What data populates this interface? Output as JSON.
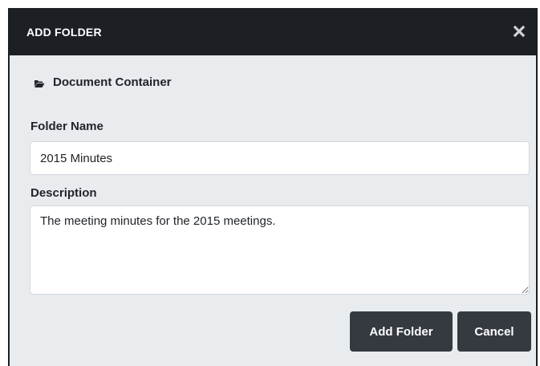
{
  "dialog": {
    "title": "ADD FOLDER",
    "close_icon": "close-icon",
    "container": {
      "icon": "folder-open-icon",
      "label": "Document Container"
    },
    "folder_name": {
      "label": "Folder Name",
      "value": "2015 Minutes"
    },
    "description": {
      "label": "Description",
      "value": "The meeting minutes for the 2015 meetings."
    },
    "buttons": {
      "add_label": "Add Folder",
      "cancel_label": "Cancel"
    }
  },
  "colors": {
    "titlebar_bg": "#1c1f24",
    "body_bg": "#e9ecef",
    "button_bg": "#343a40",
    "text": "#212529"
  }
}
